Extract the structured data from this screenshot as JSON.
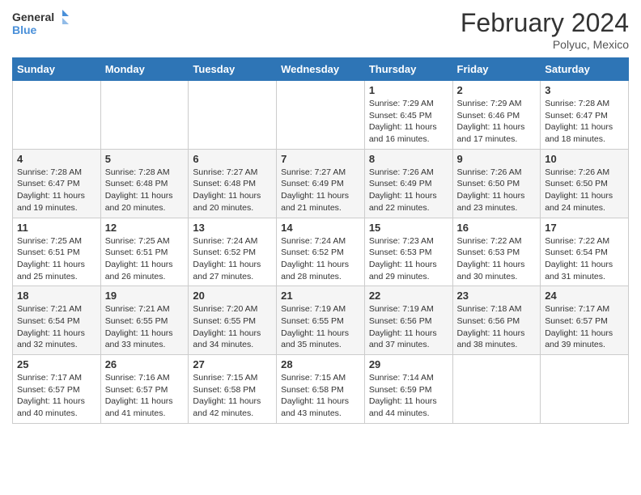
{
  "header": {
    "logo_line1": "General",
    "logo_line2": "Blue",
    "month_title": "February 2024",
    "subtitle": "Polyuc, Mexico"
  },
  "days_of_week": [
    "Sunday",
    "Monday",
    "Tuesday",
    "Wednesday",
    "Thursday",
    "Friday",
    "Saturday"
  ],
  "weeks": [
    [
      {
        "day": "",
        "info": ""
      },
      {
        "day": "",
        "info": ""
      },
      {
        "day": "",
        "info": ""
      },
      {
        "day": "",
        "info": ""
      },
      {
        "day": "1",
        "info": "Sunrise: 7:29 AM\nSunset: 6:45 PM\nDaylight: 11 hours and 16 minutes."
      },
      {
        "day": "2",
        "info": "Sunrise: 7:29 AM\nSunset: 6:46 PM\nDaylight: 11 hours and 17 minutes."
      },
      {
        "day": "3",
        "info": "Sunrise: 7:28 AM\nSunset: 6:47 PM\nDaylight: 11 hours and 18 minutes."
      }
    ],
    [
      {
        "day": "4",
        "info": "Sunrise: 7:28 AM\nSunset: 6:47 PM\nDaylight: 11 hours and 19 minutes."
      },
      {
        "day": "5",
        "info": "Sunrise: 7:28 AM\nSunset: 6:48 PM\nDaylight: 11 hours and 20 minutes."
      },
      {
        "day": "6",
        "info": "Sunrise: 7:27 AM\nSunset: 6:48 PM\nDaylight: 11 hours and 20 minutes."
      },
      {
        "day": "7",
        "info": "Sunrise: 7:27 AM\nSunset: 6:49 PM\nDaylight: 11 hours and 21 minutes."
      },
      {
        "day": "8",
        "info": "Sunrise: 7:26 AM\nSunset: 6:49 PM\nDaylight: 11 hours and 22 minutes."
      },
      {
        "day": "9",
        "info": "Sunrise: 7:26 AM\nSunset: 6:50 PM\nDaylight: 11 hours and 23 minutes."
      },
      {
        "day": "10",
        "info": "Sunrise: 7:26 AM\nSunset: 6:50 PM\nDaylight: 11 hours and 24 minutes."
      }
    ],
    [
      {
        "day": "11",
        "info": "Sunrise: 7:25 AM\nSunset: 6:51 PM\nDaylight: 11 hours and 25 minutes."
      },
      {
        "day": "12",
        "info": "Sunrise: 7:25 AM\nSunset: 6:51 PM\nDaylight: 11 hours and 26 minutes."
      },
      {
        "day": "13",
        "info": "Sunrise: 7:24 AM\nSunset: 6:52 PM\nDaylight: 11 hours and 27 minutes."
      },
      {
        "day": "14",
        "info": "Sunrise: 7:24 AM\nSunset: 6:52 PM\nDaylight: 11 hours and 28 minutes."
      },
      {
        "day": "15",
        "info": "Sunrise: 7:23 AM\nSunset: 6:53 PM\nDaylight: 11 hours and 29 minutes."
      },
      {
        "day": "16",
        "info": "Sunrise: 7:22 AM\nSunset: 6:53 PM\nDaylight: 11 hours and 30 minutes."
      },
      {
        "day": "17",
        "info": "Sunrise: 7:22 AM\nSunset: 6:54 PM\nDaylight: 11 hours and 31 minutes."
      }
    ],
    [
      {
        "day": "18",
        "info": "Sunrise: 7:21 AM\nSunset: 6:54 PM\nDaylight: 11 hours and 32 minutes."
      },
      {
        "day": "19",
        "info": "Sunrise: 7:21 AM\nSunset: 6:55 PM\nDaylight: 11 hours and 33 minutes."
      },
      {
        "day": "20",
        "info": "Sunrise: 7:20 AM\nSunset: 6:55 PM\nDaylight: 11 hours and 34 minutes."
      },
      {
        "day": "21",
        "info": "Sunrise: 7:19 AM\nSunset: 6:55 PM\nDaylight: 11 hours and 35 minutes."
      },
      {
        "day": "22",
        "info": "Sunrise: 7:19 AM\nSunset: 6:56 PM\nDaylight: 11 hours and 37 minutes."
      },
      {
        "day": "23",
        "info": "Sunrise: 7:18 AM\nSunset: 6:56 PM\nDaylight: 11 hours and 38 minutes."
      },
      {
        "day": "24",
        "info": "Sunrise: 7:17 AM\nSunset: 6:57 PM\nDaylight: 11 hours and 39 minutes."
      }
    ],
    [
      {
        "day": "25",
        "info": "Sunrise: 7:17 AM\nSunset: 6:57 PM\nDaylight: 11 hours and 40 minutes."
      },
      {
        "day": "26",
        "info": "Sunrise: 7:16 AM\nSunset: 6:57 PM\nDaylight: 11 hours and 41 minutes."
      },
      {
        "day": "27",
        "info": "Sunrise: 7:15 AM\nSunset: 6:58 PM\nDaylight: 11 hours and 42 minutes."
      },
      {
        "day": "28",
        "info": "Sunrise: 7:15 AM\nSunset: 6:58 PM\nDaylight: 11 hours and 43 minutes."
      },
      {
        "day": "29",
        "info": "Sunrise: 7:14 AM\nSunset: 6:59 PM\nDaylight: 11 hours and 44 minutes."
      },
      {
        "day": "",
        "info": ""
      },
      {
        "day": "",
        "info": ""
      }
    ]
  ]
}
